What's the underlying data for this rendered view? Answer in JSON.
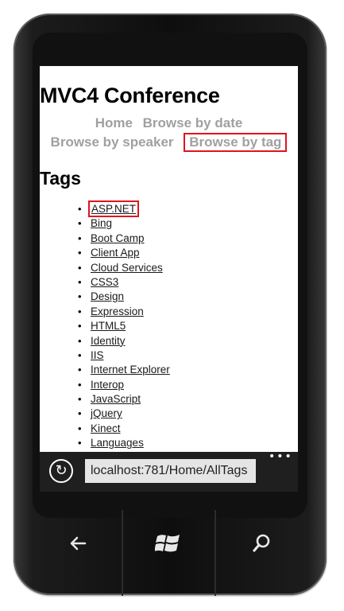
{
  "page": {
    "title": "MVC4 Conference",
    "nav": {
      "home": "Home",
      "browse_by_date": "Browse by date",
      "browse_by_speaker": "Browse by speaker",
      "browse_by_tag": "Browse by tag"
    },
    "tags_heading": "Tags",
    "tags": [
      "ASP.NET",
      "Bing",
      "Boot Camp",
      "Client App",
      "Cloud Services",
      "CSS3",
      "Design",
      "Expression",
      "HTML5",
      "Identity",
      "IIS",
      "Internet Explorer",
      "Interop",
      "JavaScript",
      "jQuery",
      "Kinect",
      "Languages"
    ]
  },
  "browser": {
    "url": "localhost:781/Home/AllTags",
    "refresh_icon": "refresh-icon",
    "more_icon": "more-icon"
  },
  "hardware": {
    "back_icon": "back-arrow-icon",
    "start_icon": "windows-logo-icon",
    "search_icon": "search-icon"
  },
  "colors": {
    "highlight": "#e0141e",
    "nav_text": "#a0a0a0",
    "addressbar": "#1f1f1f"
  }
}
